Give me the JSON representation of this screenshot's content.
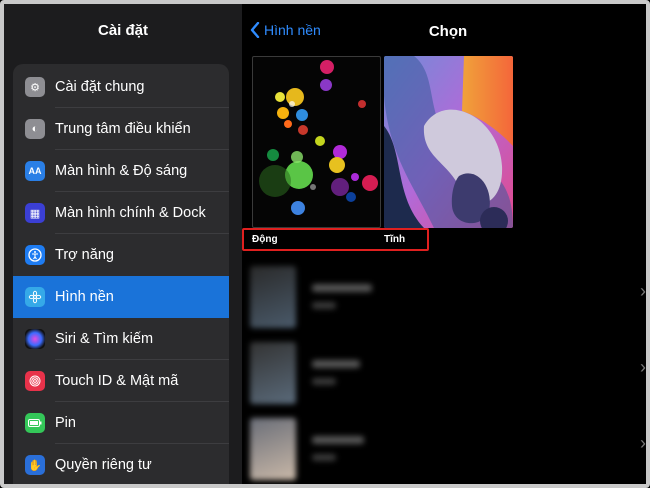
{
  "sidebar": {
    "title": "Cài đặt",
    "items": [
      {
        "label": "Cài đặt chung",
        "icon": "gear-icon",
        "color": "#8e8e93",
        "glyph": "⚙"
      },
      {
        "label": "Trung tâm điều khiển",
        "icon": "toggles-icon",
        "color": "#8e8e93",
        "glyph": "◐"
      },
      {
        "label": "Màn hình & Độ sáng",
        "icon": "text-size-icon",
        "color": "#2a7fe6",
        "glyph": "AA"
      },
      {
        "label": "Màn hình chính & Dock",
        "icon": "home-grid-icon",
        "color": "#3b3fd4",
        "glyph": "▦"
      },
      {
        "label": "Trợ năng",
        "icon": "accessibility-icon",
        "color": "#1e7cf2",
        "glyph": "♿"
      },
      {
        "label": "Hình nền",
        "icon": "wallpaper-icon",
        "color": "#35a9e8",
        "glyph": "✿",
        "selected": true
      },
      {
        "label": "Siri & Tìm kiếm",
        "icon": "siri-icon",
        "color": "#1a1a2e",
        "glyph": "◉"
      },
      {
        "label": "Touch ID & Mật mã",
        "icon": "fingerprint-icon",
        "color": "#e8324a",
        "glyph": "◎"
      },
      {
        "label": "Pin",
        "icon": "battery-icon",
        "color": "#34c759",
        "glyph": "▬"
      },
      {
        "label": "Quyền riêng tư",
        "icon": "hand-icon",
        "color": "#2a6fd9",
        "glyph": "✋"
      }
    ]
  },
  "main": {
    "back_label": "Hình nền",
    "title": "Chọn",
    "options": [
      {
        "caption": "Động"
      },
      {
        "caption": "Tĩnh"
      }
    ],
    "chevron": "›"
  },
  "colors": {
    "accent": "#2f8cff",
    "selected_row": "#1a73d9",
    "highlight_box": "#e0201f"
  }
}
